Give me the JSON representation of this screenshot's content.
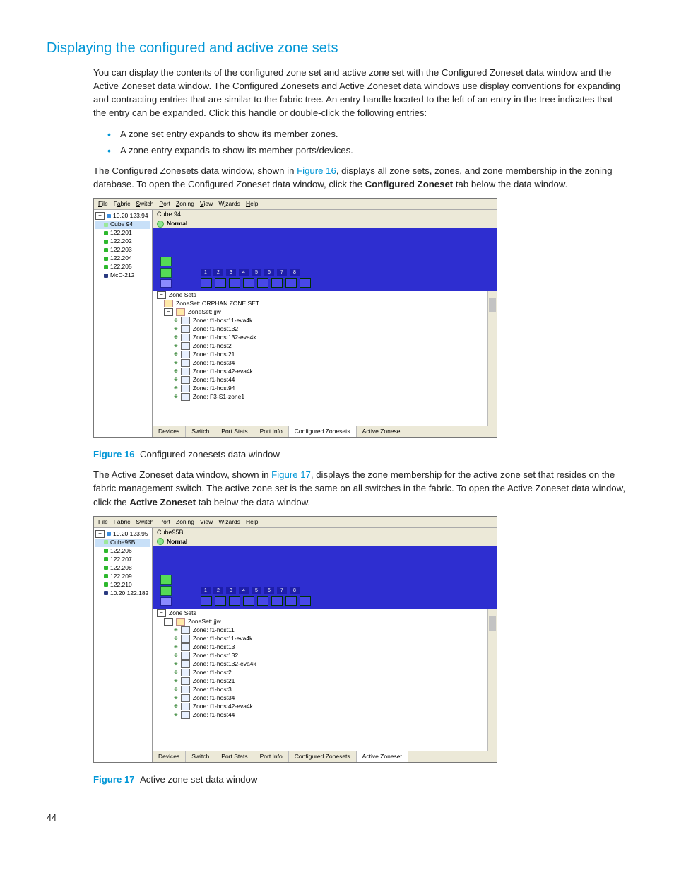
{
  "section": {
    "title": "Displaying the configured and active zone sets",
    "para1": "You can display the contents of the configured zone set and active zone set with the Configured Zoneset data window and the Active Zoneset data window. The Configured Zonesets and Active Zoneset data windows use display conventions for expanding and contracting entries that are similar to the fabric tree. An entry handle located to the left of an entry in the tree indicates that the entry can be expanded. Click this handle or double-click the following entries:",
    "bullets": [
      "A zone set entry expands to show its member zones.",
      "A zone entry expands to show its member ports/devices."
    ],
    "para2a": "The Configured Zonesets data window, shown in ",
    "para2_link": "Figure 16",
    "para2b": ", displays all zone sets, zones, and zone membership in the zoning database. To open the Configured Zoneset data window, click the ",
    "para2_bold": "Configured Zoneset",
    "para2c": " tab below the data window.",
    "fig16_label": "Figure 16",
    "fig16_cap": "Configured zonesets data window",
    "para3a": "The Active Zoneset data window, shown in ",
    "para3_link": "Figure 17",
    "para3b": ", displays the zone membership for the active zone set that resides on the fabric management switch. The active zone set is the same on all switches in the fabric. To open the Active Zoneset data window, click the ",
    "para3_bold": "Active Zoneset",
    "para3c": " tab below the data window.",
    "fig17_label": "Figure 17",
    "fig17_cap": "Active zone set data window",
    "page": "44"
  },
  "shot_common": {
    "menu": [
      "File",
      "Fabric",
      "Switch",
      "Port",
      "Zoning",
      "View",
      "Wizards",
      "Help"
    ],
    "status_normal": "Normal",
    "zone_sets": "Zone Sets",
    "tabs": [
      "Devices",
      "Switch",
      "Port Stats",
      "Port Info",
      "Configured Zonesets",
      "Active Zoneset"
    ],
    "port_nums": [
      "1",
      "2",
      "3",
      "4",
      "5",
      "6",
      "7",
      "8"
    ]
  },
  "fig16": {
    "fabric_root": "10.20.123.94",
    "fabric_sel": "Cube 94",
    "fabric_items": [
      "122.201",
      "122.202",
      "122.203",
      "122.204",
      "122.205",
      "McD-212"
    ],
    "title": "Cube 94",
    "zs_orphan": "ZoneSet: ORPHAN ZONE SET",
    "zs_main": "ZoneSet: jjw",
    "zones": [
      "Zone: f1-host11-eva4k",
      "Zone: f1-host132",
      "Zone: f1-host132-eva4k",
      "Zone: f1-host2",
      "Zone: f1-host21",
      "Zone: f1-host34",
      "Zone: f1-host42-eva4k",
      "Zone: f1-host44",
      "Zone: f1-host94",
      "Zone: F3-S1-zone1"
    ],
    "active_tab": 4
  },
  "fig17": {
    "fabric_root": "10.20.123.95",
    "fabric_sel": "Cube95B",
    "fabric_items": [
      "122.206",
      "122.207",
      "122.208",
      "122.209",
      "122.210",
      "10.20.122.182"
    ],
    "title": "Cube95B",
    "zs_main": "ZoneSet: jjw",
    "zones": [
      "Zone: f1-host11",
      "Zone: f1-host11-eva4k",
      "Zone: f1-host13",
      "Zone: f1-host132",
      "Zone: f1-host132-eva4k",
      "Zone: f1-host2",
      "Zone: f1-host21",
      "Zone: f1-host3",
      "Zone: f1-host34",
      "Zone: f1-host42-eva4k",
      "Zone: f1-host44"
    ],
    "active_tab": 5
  }
}
